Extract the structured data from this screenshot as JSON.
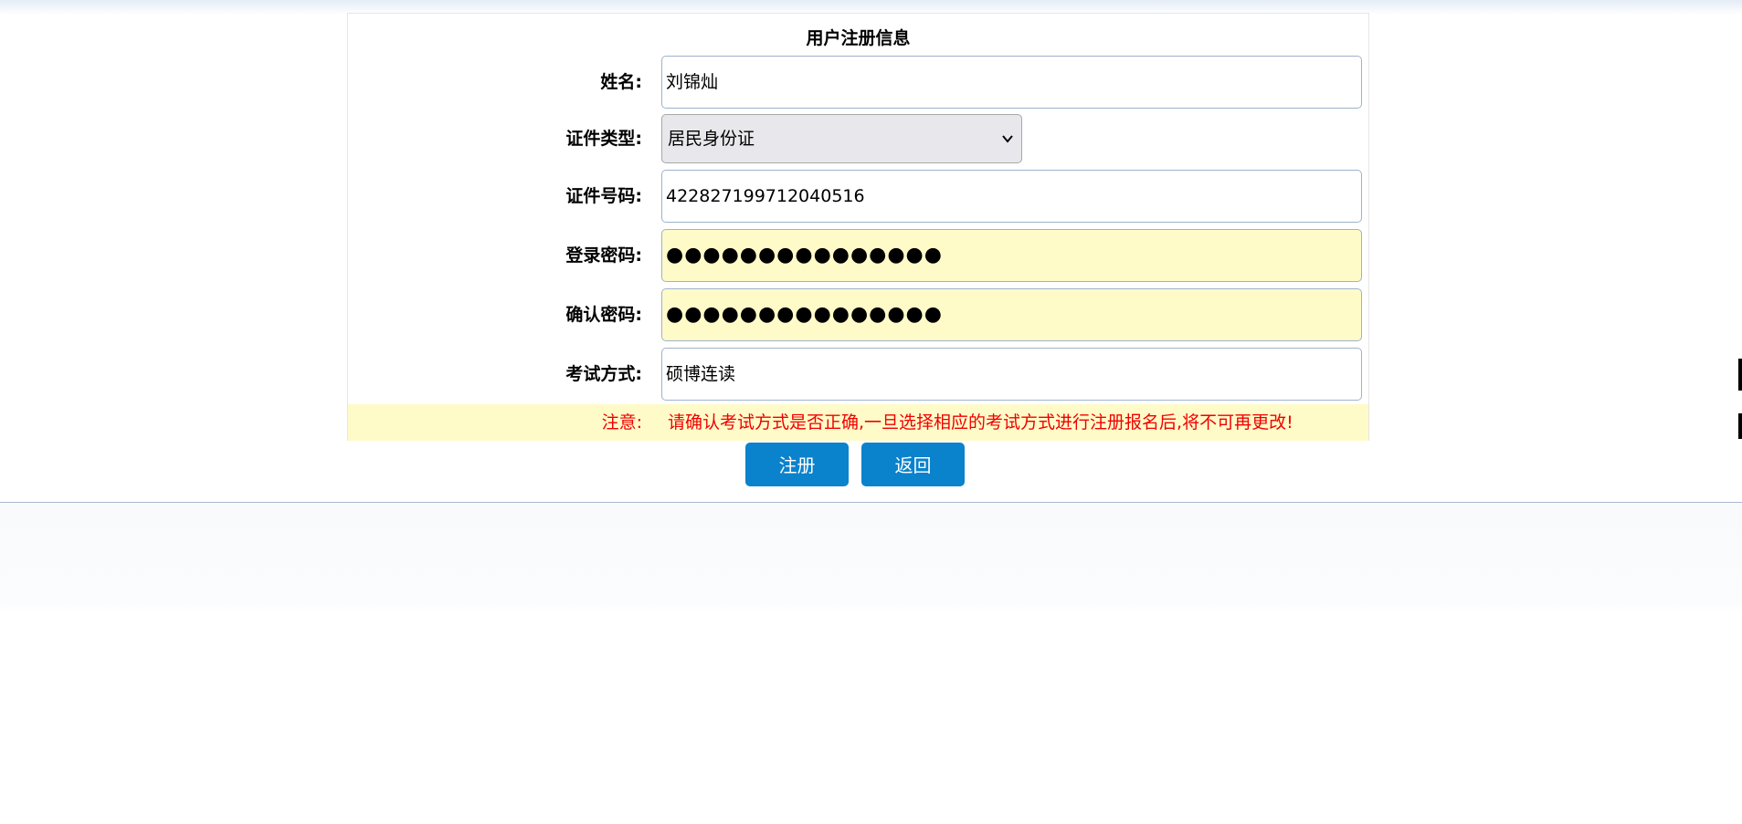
{
  "form": {
    "title": "用户注册信息",
    "fields": {
      "name": {
        "label": "姓名:",
        "value": "刘锦灿"
      },
      "id_type": {
        "label": "证件类型:",
        "selected": "居民身份证"
      },
      "id_number": {
        "label": "证件号码:",
        "value": "422827199712040516"
      },
      "password": {
        "label": "登录密码:",
        "masked": "●●●●●●●●●●●●●●●"
      },
      "confirm_password": {
        "label": "确认密码:",
        "masked": "●●●●●●●●●●●●●●●"
      },
      "exam_mode": {
        "label": "考试方式:",
        "value": "硕博连读"
      }
    },
    "notice": {
      "label": "注意:",
      "text": "请确认考试方式是否正确,一旦选择相应的考试方式进行注册报名后,将不可再更改!"
    }
  },
  "buttons": {
    "register": "注册",
    "back": "返回"
  },
  "colors": {
    "button_bg": "#0a82cc",
    "notice_text": "#f00000",
    "password_bg": "#fffbc8"
  }
}
